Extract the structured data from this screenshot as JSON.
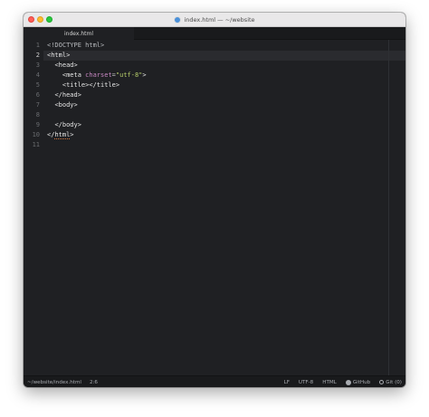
{
  "window": {
    "title": "index.html — ~/website"
  },
  "tabs": [
    {
      "label": "index.html"
    }
  ],
  "editor": {
    "active_line": 2,
    "line_numbers": [
      "1",
      "2",
      "3",
      "4",
      "5",
      "6",
      "7",
      "8",
      "9",
      "10",
      "11"
    ],
    "lines": [
      {
        "parts": [
          {
            "t": "doctype",
            "s": "<!DOCTYPE html>"
          }
        ]
      },
      {
        "parts": [
          {
            "t": "tag",
            "s": "<html>"
          }
        ]
      },
      {
        "parts": [
          {
            "t": "plain",
            "s": "  "
          },
          {
            "t": "tag",
            "s": "<head>"
          }
        ]
      },
      {
        "parts": [
          {
            "t": "plain",
            "s": "    "
          },
          {
            "t": "tag",
            "s": "<meta "
          },
          {
            "t": "attr",
            "s": "charset"
          },
          {
            "t": "eq",
            "s": "="
          },
          {
            "t": "str",
            "s": "\"utf-8\""
          },
          {
            "t": "tag",
            "s": ">"
          }
        ]
      },
      {
        "parts": [
          {
            "t": "plain",
            "s": "    "
          },
          {
            "t": "tag",
            "s": "<title></title>"
          }
        ]
      },
      {
        "parts": [
          {
            "t": "plain",
            "s": "  "
          },
          {
            "t": "tag",
            "s": "</head>"
          }
        ]
      },
      {
        "parts": [
          {
            "t": "plain",
            "s": "  "
          },
          {
            "t": "tag",
            "s": "<body>"
          }
        ]
      },
      {
        "parts": [
          {
            "t": "plain",
            "s": ""
          }
        ]
      },
      {
        "parts": [
          {
            "t": "plain",
            "s": "  "
          },
          {
            "t": "tag",
            "s": "</body>"
          }
        ]
      },
      {
        "parts": [
          {
            "t": "tag",
            "s": "</"
          },
          {
            "t": "tag_err",
            "s": "html"
          },
          {
            "t": "tag",
            "s": ">"
          }
        ]
      },
      {
        "parts": [
          {
            "t": "plain",
            "s": ""
          }
        ]
      }
    ]
  },
  "statusbar": {
    "file_path": "~/website/index.html",
    "cursor_position": "2:6",
    "line_ending": "LF",
    "encoding": "UTF-8",
    "grammar": "HTML",
    "github_label": "GitHub",
    "git_label": "Git (0)"
  },
  "colors": {
    "editor_bg": "#1f2023",
    "statusbar_bg": "#191a1c",
    "attr": "#c586c0",
    "string": "#b5cc6a"
  }
}
